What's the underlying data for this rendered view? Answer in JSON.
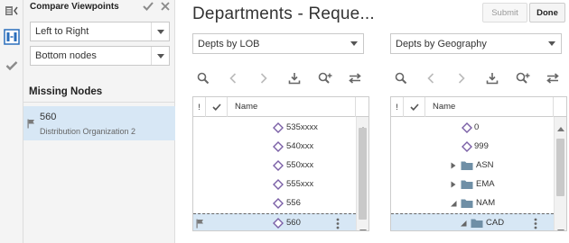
{
  "title": "Departments - Reque...",
  "actions": {
    "submit": "Submit",
    "done": "Done"
  },
  "compare_panel": {
    "title": "Compare Viewpoints",
    "direction": "Left to Right",
    "nodes_filter": "Bottom nodes",
    "missing_title": "Missing Nodes",
    "missing_item": {
      "name": "560",
      "description": "Distribution Organization 2"
    }
  },
  "left_viewpoint": {
    "selected": "Depts by LOB",
    "column_name": "Name",
    "rows": [
      {
        "label": "535xxxx"
      },
      {
        "label": "540xxx"
      },
      {
        "label": "550xxx"
      },
      {
        "label": "555xxx"
      },
      {
        "label": "556"
      },
      {
        "label": "560"
      }
    ]
  },
  "right_viewpoint": {
    "selected": "Depts by Geography",
    "column_name": "Name",
    "rows": [
      {
        "label": "0"
      },
      {
        "label": "999"
      },
      {
        "label": "ASN"
      },
      {
        "label": "EMA"
      },
      {
        "label": "NAM"
      },
      {
        "label": "CAD"
      }
    ]
  },
  "colors": {
    "accent": "#7a5fa6",
    "selection": "#d7e7f5",
    "folder": "#6f8fa6"
  }
}
